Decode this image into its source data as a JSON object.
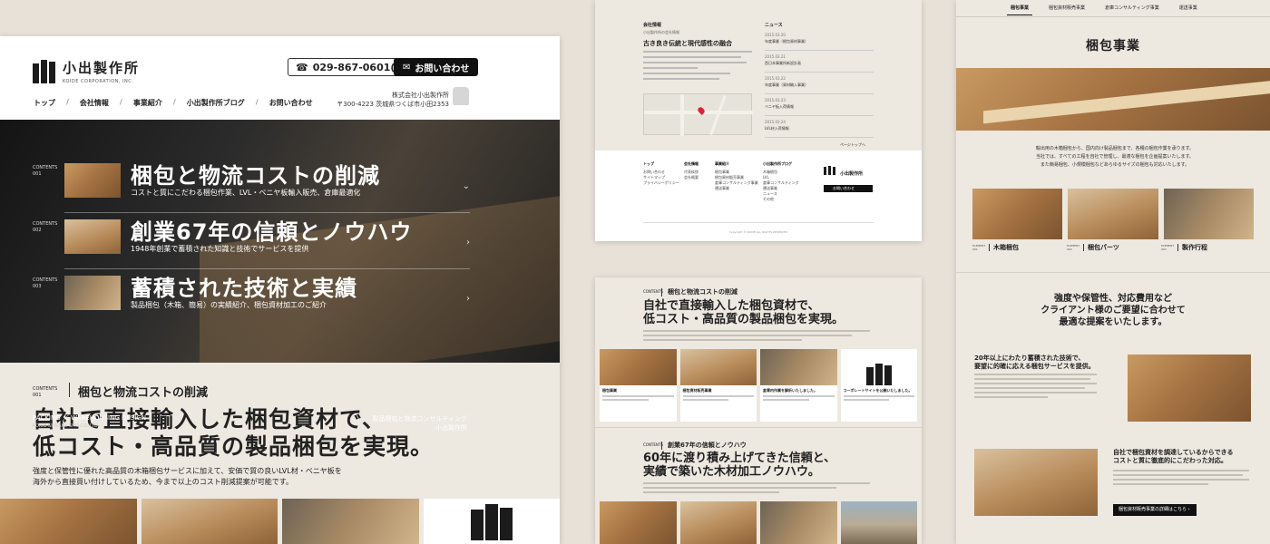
{
  "left": {
    "logo": {
      "kanji": "小出製作所",
      "en": "KOIDE CORPORATION, INC."
    },
    "phone": "029-867-0601(代)",
    "contact": "お問い合わせ",
    "nav": [
      "トップ",
      "会社情報",
      "事業紹介",
      "小出製作所ブログ",
      "お問い合わせ"
    ],
    "address": {
      "company": "株式会社小出製作所",
      "postal": "〒300-4223 茨城県つくば市小田2353"
    },
    "hero_items": [
      {
        "label": "CONTENTS",
        "num": "001",
        "title": "梱包と物流コストの削減",
        "sub": "コストと質にこだわる梱包作業、LVL・ベニヤ板輸入販売、倉庫最適化"
      },
      {
        "label": "CONTENTS",
        "num": "002",
        "title": "創業67年の信頼とノウハウ",
        "sub": "1948年創業で蓄積された知識と技術でサービスを提供"
      },
      {
        "label": "CONTENTS",
        "num": "003",
        "title": "蓄積された技術と実績",
        "sub": "製品梱包（木箱、簡易）の実績紹介、梱包資材加工のご紹介"
      }
    ],
    "hero_bottom_left": "PACKING ／ WAREHOUSING DESIGN",
    "hero_bottom_left2": "KOIDE SEISAKU SHO CO.,LTD",
    "hero_bottom_right": [
      "製品梱包と物流コンサルティング",
      "小出製作所"
    ],
    "section": {
      "label": "CONTENTS",
      "num": "001",
      "title": "梱包と物流コストの削減",
      "headline": [
        "自社で直接輸入した梱包資材で、",
        "低コスト・高品質の製品梱包を実現。"
      ],
      "body": [
        "強度と保管性に優れた高品質の木箱梱包サービスに加えて、安価で質の良いLVL材・ベニヤ板を",
        "海外から直接買い付けしているため、今まで以上のコスト削減提案が可能です。"
      ]
    }
  },
  "mid_top": {
    "company_head": "会社情報",
    "company_sub": "小出製作所の会社情報",
    "company_title": "古き良き伝統と現代感性の融合",
    "news_head": "ニュース",
    "news": [
      {
        "date": "2015.03.20",
        "text": "年度事業（梱包資材事業）"
      },
      {
        "date": "2015.03.21",
        "text": "西日本事業所新設計画"
      },
      {
        "date": "2015.03.22",
        "text": "年度事業（資材輸入事業）"
      },
      {
        "date": "2015.03.23",
        "text": "ベニヤ板入荷情報"
      },
      {
        "date": "2015.03.24",
        "text": "LVL材入荷情報"
      }
    ],
    "news_more": "ページトップへ",
    "footer_cols": [
      {
        "title": "トップ",
        "items": [
          "お問い合わせ",
          "サイトマップ",
          "プライバシーポリシー"
        ]
      },
      {
        "title": "会社情報",
        "items": [
          "代表挨拶",
          "会社概要"
        ]
      },
      {
        "title": "事業紹介",
        "items": [
          "梱包事業",
          "梱包資材販売事業",
          "倉庫コンサルティング事業",
          "運送事業"
        ]
      },
      {
        "title": "小出製作所ブログ",
        "items": [
          "木箱梱包",
          "LVL",
          "倉庫コンサルティング",
          "運送事業",
          "ニュース",
          "その他"
        ]
      }
    ],
    "footer_btn": "お問い合わせ",
    "copyright": "Copyright © KOIDE ALL RIGHTS RESERVED"
  },
  "mid_bottom": {
    "s1_label": "CONTENTS",
    "s1_title": "梱包と物流コストの削減",
    "s1_headline": [
      "自社で直接輸入した梱包資材で、",
      "低コスト・高品質の製品梱包を実現。"
    ],
    "cards": [
      "梱包事業",
      "梱包資材販売事業",
      "倉庫内作業を解析いたしました。",
      "コーポレートサイトを公開いたしました。"
    ],
    "s2_label": "CONTENTS",
    "s2_title": "創業67年の信頼とノウハウ",
    "s2_headline": [
      "60年に渡り積み上げてきた信頼と、",
      "実績で築いた木材加工ノウハウ。"
    ]
  },
  "right": {
    "tabs": [
      "梱包事業",
      "梱包資材販売事業",
      "倉庫コンサルティング事業",
      "運送事業"
    ],
    "title": "梱包事業",
    "intro": [
      "輸出用の木箱梱包から、国内向け製品梱包まで、各種の梱包作業を承ります。",
      "当社では、すべての工程を自社で管理し、最適な梱包を企画提案いたします。",
      "また簡易梱包、小規模梱包などあらゆるサイズの梱包も対応いたします。"
    ],
    "elements": [
      {
        "label": "ELEMENT",
        "num": "001",
        "name": "木箱梱包"
      },
      {
        "label": "ELEMENT",
        "num": "002",
        "name": "梱包パーツ"
      },
      {
        "label": "ELEMENT",
        "num": "003",
        "name": "製作行程"
      }
    ],
    "headline": [
      "強度や保管性、対応費用など",
      "クライアント様のご要望に合わせて",
      "最適な提案をいたします。"
    ],
    "block1_title": [
      "20年以上にわたり蓄積された技術で、",
      "要望に的確に応える梱包サービスを提供。"
    ],
    "block2_title": [
      "自社で梱包資材を調達しているからできる",
      "コストと質に徹底的にこだわった対応。"
    ],
    "block2_btn": "梱包資材販売事業の詳細はこちら ›"
  },
  "colors": {
    "accent": "#111111",
    "background": "#e8e1d8",
    "panel_beige": "#ede8e0"
  }
}
